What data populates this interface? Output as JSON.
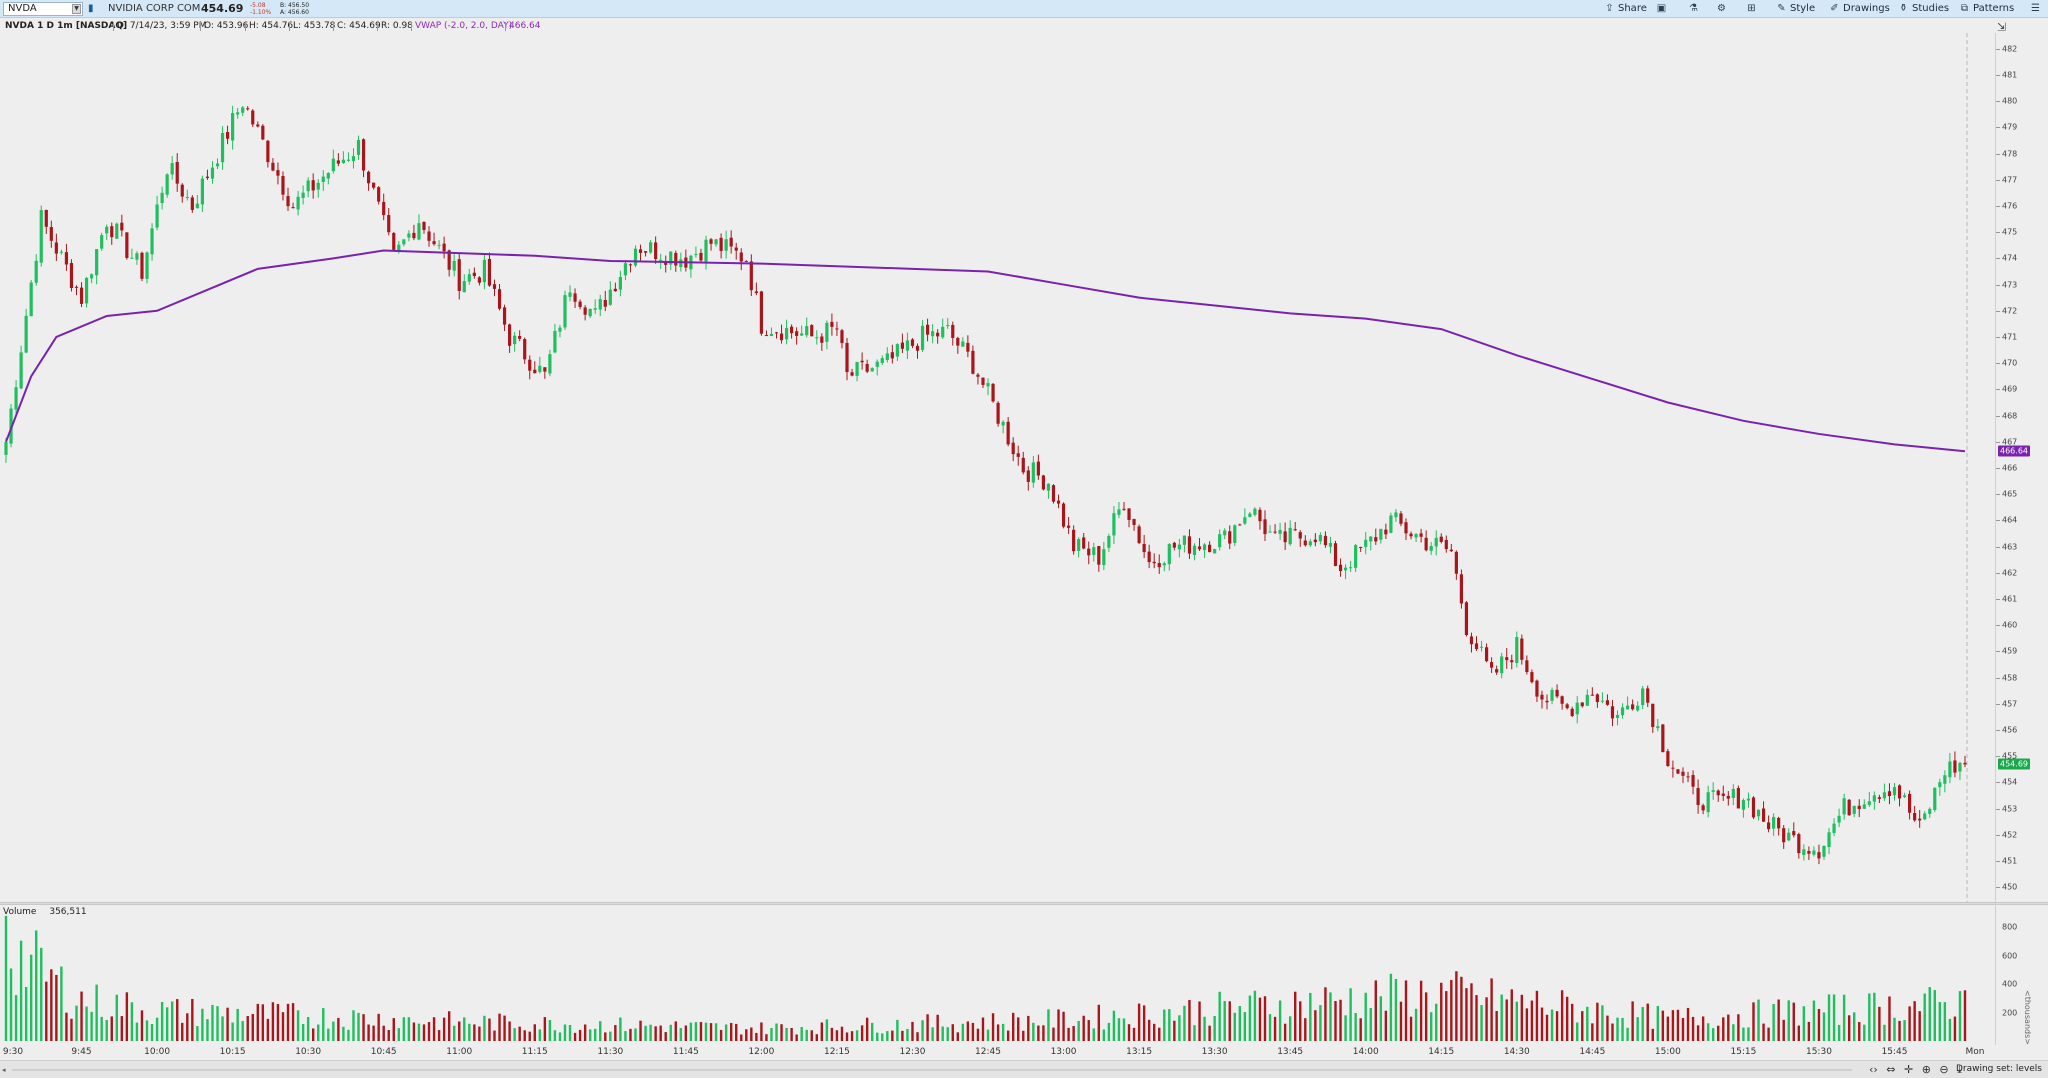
{
  "toolbar": {
    "symbol": "NVDA",
    "company": "NVIDIA CORP COM",
    "last": "454.69",
    "change": "-5.08",
    "change_pct": "-1.10%",
    "bid": "B: 456.50",
    "ask": "A: 456.60",
    "buttons": [
      "Share",
      "Style",
      "Drawings",
      "Studies",
      "Patterns"
    ]
  },
  "info": {
    "title": "NVDA 1 D 1m [NASDAQ]",
    "date": "D: 7/14/23, 3:59 PM",
    "open": "O: 453.96",
    "high": "H: 454.76",
    "low": "L: 453.78",
    "close": "C: 454.69",
    "range": "R: 0.98",
    "vwap_label": "VWAP (-2.0, 2.0, DAY)",
    "vwap_value": "466.64"
  },
  "price_axis": {
    "ticks": [
      "482",
      "481",
      "480",
      "479",
      "478",
      "477",
      "476",
      "475",
      "474",
      "473",
      "472",
      "471",
      "470",
      "469",
      "468",
      "467",
      "466",
      "465",
      "464",
      "463",
      "462",
      "461",
      "460",
      "459",
      "458",
      "457",
      "456",
      "455",
      "454",
      "453",
      "452",
      "451",
      "450"
    ],
    "last_tag": "454.69",
    "vwap_tag": "466.64"
  },
  "volume": {
    "label": "Volume",
    "value": "356,511",
    "ticks": [
      "800",
      "600",
      "400",
      "200"
    ],
    "unit": "<thousands>"
  },
  "time_axis": [
    "9:30",
    "9:45",
    "10:00",
    "10:15",
    "10:30",
    "10:45",
    "11:00",
    "11:15",
    "11:30",
    "11:45",
    "12:00",
    "12:15",
    "12:30",
    "12:45",
    "13:00",
    "13:15",
    "13:30",
    "13:45",
    "14:00",
    "14:15",
    "14:30",
    "14:45",
    "15:00",
    "15:15",
    "15:30",
    "15:45",
    "Mon"
  ],
  "status": {
    "drawing_set": "Drawing set: levels"
  },
  "chart_data": {
    "type": "candlestick",
    "symbol": "NVDA",
    "interval": "1m",
    "ylim": [
      450,
      482
    ],
    "anchor_points": [
      {
        "x": "9:30",
        "close": 467.0
      },
      {
        "x": "9:37",
        "close": 475.5
      },
      {
        "x": "9:45",
        "close": 472.5
      },
      {
        "x": "9:50",
        "close": 475.5
      },
      {
        "x": "9:57",
        "close": 473.5
      },
      {
        "x": "10:02",
        "close": 477.5
      },
      {
        "x": "10:07",
        "close": 476.0
      },
      {
        "x": "10:12",
        "close": 478.0
      },
      {
        "x": "10:17",
        "close": 480.0
      },
      {
        "x": "10:22",
        "close": 478.0
      },
      {
        "x": "10:27",
        "close": 476.0
      },
      {
        "x": "10:35",
        "close": 477.5
      },
      {
        "x": "10:40",
        "close": 478.3
      },
      {
        "x": "10:47",
        "close": 474.0
      },
      {
        "x": "10:52",
        "close": 475.5
      },
      {
        "x": "11:00",
        "close": 473.2
      },
      {
        "x": "11:05",
        "close": 473.5
      },
      {
        "x": "11:10",
        "close": 471.0
      },
      {
        "x": "11:17",
        "close": 469.5
      },
      {
        "x": "11:22",
        "close": 473.0
      },
      {
        "x": "11:27",
        "close": 471.8
      },
      {
        "x": "11:35",
        "close": 474.5
      },
      {
        "x": "11:45",
        "close": 474.0
      },
      {
        "x": "11:50",
        "close": 474.6
      },
      {
        "x": "11:57",
        "close": 474.0
      },
      {
        "x": "12:00",
        "close": 471.5
      },
      {
        "x": "12:10",
        "close": 471.0
      },
      {
        "x": "12:15",
        "close": 471.3
      },
      {
        "x": "12:17",
        "close": 469.5
      },
      {
        "x": "12:25",
        "close": 470.0
      },
      {
        "x": "12:32",
        "close": 471.0
      },
      {
        "x": "12:37",
        "close": 471.2
      },
      {
        "x": "12:42",
        "close": 470.0
      },
      {
        "x": "12:47",
        "close": 468.0
      },
      {
        "x": "12:52",
        "close": 466.0
      },
      {
        "x": "12:57",
        "close": 465.5
      },
      {
        "x": "13:02",
        "close": 463.0
      },
      {
        "x": "13:07",
        "close": 462.6
      },
      {
        "x": "13:12",
        "close": 464.8
      },
      {
        "x": "13:17",
        "close": 462.4
      },
      {
        "x": "13:22",
        "close": 463.0
      },
      {
        "x": "13:32",
        "close": 463.3
      },
      {
        "x": "13:37",
        "close": 464.5
      },
      {
        "x": "13:42",
        "close": 463.2
      },
      {
        "x": "13:50",
        "close": 463.5
      },
      {
        "x": "13:55",
        "close": 462.2
      },
      {
        "x": "14:00",
        "close": 463.0
      },
      {
        "x": "14:05",
        "close": 464.0
      },
      {
        "x": "14:12",
        "close": 463.2
      },
      {
        "x": "14:17",
        "close": 462.8
      },
      {
        "x": "14:20",
        "close": 460.0
      },
      {
        "x": "14:25",
        "close": 458.0
      },
      {
        "x": "14:30",
        "close": 459.2
      },
      {
        "x": "14:35",
        "close": 457.3
      },
      {
        "x": "14:40",
        "close": 456.8
      },
      {
        "x": "14:45",
        "close": 457.5
      },
      {
        "x": "14:50",
        "close": 456.5
      },
      {
        "x": "14:55",
        "close": 457.6
      },
      {
        "x": "15:00",
        "close": 455.0
      },
      {
        "x": "15:05",
        "close": 453.5
      },
      {
        "x": "15:10",
        "close": 453.2
      },
      {
        "x": "15:15",
        "close": 453.5
      },
      {
        "x": "15:20",
        "close": 452.4
      },
      {
        "x": "15:25",
        "close": 451.8
      },
      {
        "x": "15:30",
        "close": 451.5
      },
      {
        "x": "15:35",
        "close": 453.0
      },
      {
        "x": "15:40",
        "close": 453.6
      },
      {
        "x": "15:45",
        "close": 453.9
      },
      {
        "x": "15:50",
        "close": 452.2
      },
      {
        "x": "15:55",
        "close": 454.5
      },
      {
        "x": "15:59",
        "close": 454.69
      }
    ],
    "vwap": [
      {
        "x": "9:30",
        "y": 467.0
      },
      {
        "x": "9:35",
        "y": 469.5
      },
      {
        "x": "9:40",
        "y": 471.0
      },
      {
        "x": "9:50",
        "y": 471.8
      },
      {
        "x": "10:00",
        "y": 472.0
      },
      {
        "x": "10:10",
        "y": 472.8
      },
      {
        "x": "10:20",
        "y": 473.6
      },
      {
        "x": "10:35",
        "y": 474.0
      },
      {
        "x": "10:45",
        "y": 474.3
      },
      {
        "x": "11:00",
        "y": 474.2
      },
      {
        "x": "11:15",
        "y": 474.1
      },
      {
        "x": "11:30",
        "y": 473.9
      },
      {
        "x": "12:00",
        "y": 473.8
      },
      {
        "x": "12:30",
        "y": 473.6
      },
      {
        "x": "12:45",
        "y": 473.5
      },
      {
        "x": "13:00",
        "y": 473.0
      },
      {
        "x": "13:15",
        "y": 472.5
      },
      {
        "x": "13:30",
        "y": 472.2
      },
      {
        "x": "13:45",
        "y": 471.9
      },
      {
        "x": "14:00",
        "y": 471.7
      },
      {
        "x": "14:15",
        "y": 471.3
      },
      {
        "x": "14:30",
        "y": 470.3
      },
      {
        "x": "14:45",
        "y": 469.4
      },
      {
        "x": "15:00",
        "y": 468.5
      },
      {
        "x": "15:15",
        "y": 467.8
      },
      {
        "x": "15:30",
        "y": 467.3
      },
      {
        "x": "15:45",
        "y": 466.9
      },
      {
        "x": "15:59",
        "y": 466.64
      }
    ],
    "volume_ylim": [
      0,
      900
    ],
    "volume_thousands_approx": [
      {
        "x": "9:30",
        "v": 880
      },
      {
        "x": "9:45",
        "v": 380
      },
      {
        "x": "10:00",
        "v": 280
      },
      {
        "x": "10:15",
        "v": 260
      },
      {
        "x": "11:00",
        "v": 180
      },
      {
        "x": "12:00",
        "v": 120
      },
      {
        "x": "13:00",
        "v": 200
      },
      {
        "x": "14:15",
        "v": 450
      },
      {
        "x": "15:00",
        "v": 210
      },
      {
        "x": "15:59",
        "v": 356.511
      }
    ],
    "colors": {
      "up": "#1fbf5f",
      "down": "#a8161b",
      "vwap": "#7a22b0",
      "last_tag": "#18a94a"
    }
  }
}
